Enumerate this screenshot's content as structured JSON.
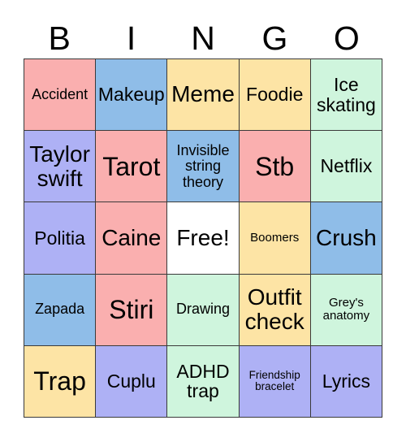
{
  "card": {
    "title": "BINGO",
    "header_letters": [
      "B",
      "I",
      "N",
      "G",
      "O"
    ],
    "colors": {
      "pink": "#faafaf",
      "blue": "#8fbde8",
      "yellow": "#fde4a5",
      "mint": "#cff5dd",
      "periwinkle": "#aeb1f5",
      "white": "#ffffff",
      "border": "#3a3a3a",
      "text": "#000000"
    },
    "grid": {
      "rows": 5,
      "columns": 5,
      "free_space": "Free!",
      "cells": [
        [
          {
            "label": "Accident",
            "color": "pink",
            "size": "sm"
          },
          {
            "label": "Makeup",
            "color": "blue",
            "size": "md"
          },
          {
            "label": "Meme",
            "color": "yellow",
            "size": "lg"
          },
          {
            "label": "Foodie",
            "color": "yellow",
            "size": "md"
          },
          {
            "label": "Ice skating",
            "color": "mint",
            "size": "md"
          }
        ],
        [
          {
            "label": "Taylor swift",
            "color": "periwinkle",
            "size": "lg"
          },
          {
            "label": "Tarot",
            "color": "pink",
            "size": "xl"
          },
          {
            "label": "Invisible string theory",
            "color": "blue",
            "size": "sm"
          },
          {
            "label": "Stb",
            "color": "pink",
            "size": "xl"
          },
          {
            "label": "Netflix",
            "color": "mint",
            "size": "md"
          }
        ],
        [
          {
            "label": "Politia",
            "color": "periwinkle",
            "size": "md"
          },
          {
            "label": "Caine",
            "color": "pink",
            "size": "lg"
          },
          {
            "label": "Free!",
            "color": "white",
            "size": "lg"
          },
          {
            "label": "Boomers",
            "color": "yellow",
            "size": "xs"
          },
          {
            "label": "Crush",
            "color": "blue",
            "size": "lg"
          }
        ],
        [
          {
            "label": "Zapada",
            "color": "blue",
            "size": "sm"
          },
          {
            "label": "Stiri",
            "color": "pink",
            "size": "xl"
          },
          {
            "label": "Drawing",
            "color": "mint",
            "size": "sm"
          },
          {
            "label": "Outfit check",
            "color": "yellow",
            "size": "lg"
          },
          {
            "label": "Grey's anatomy",
            "color": "mint",
            "size": "xs"
          }
        ],
        [
          {
            "label": "Trap",
            "color": "yellow",
            "size": "xl"
          },
          {
            "label": "Cuplu",
            "color": "periwinkle",
            "size": "md"
          },
          {
            "label": "ADHD trap",
            "color": "mint",
            "size": "md"
          },
          {
            "label": "Friendship bracelet",
            "color": "periwinkle",
            "size": "xxs"
          },
          {
            "label": "Lyrics",
            "color": "periwinkle",
            "size": "md"
          }
        ]
      ]
    }
  }
}
